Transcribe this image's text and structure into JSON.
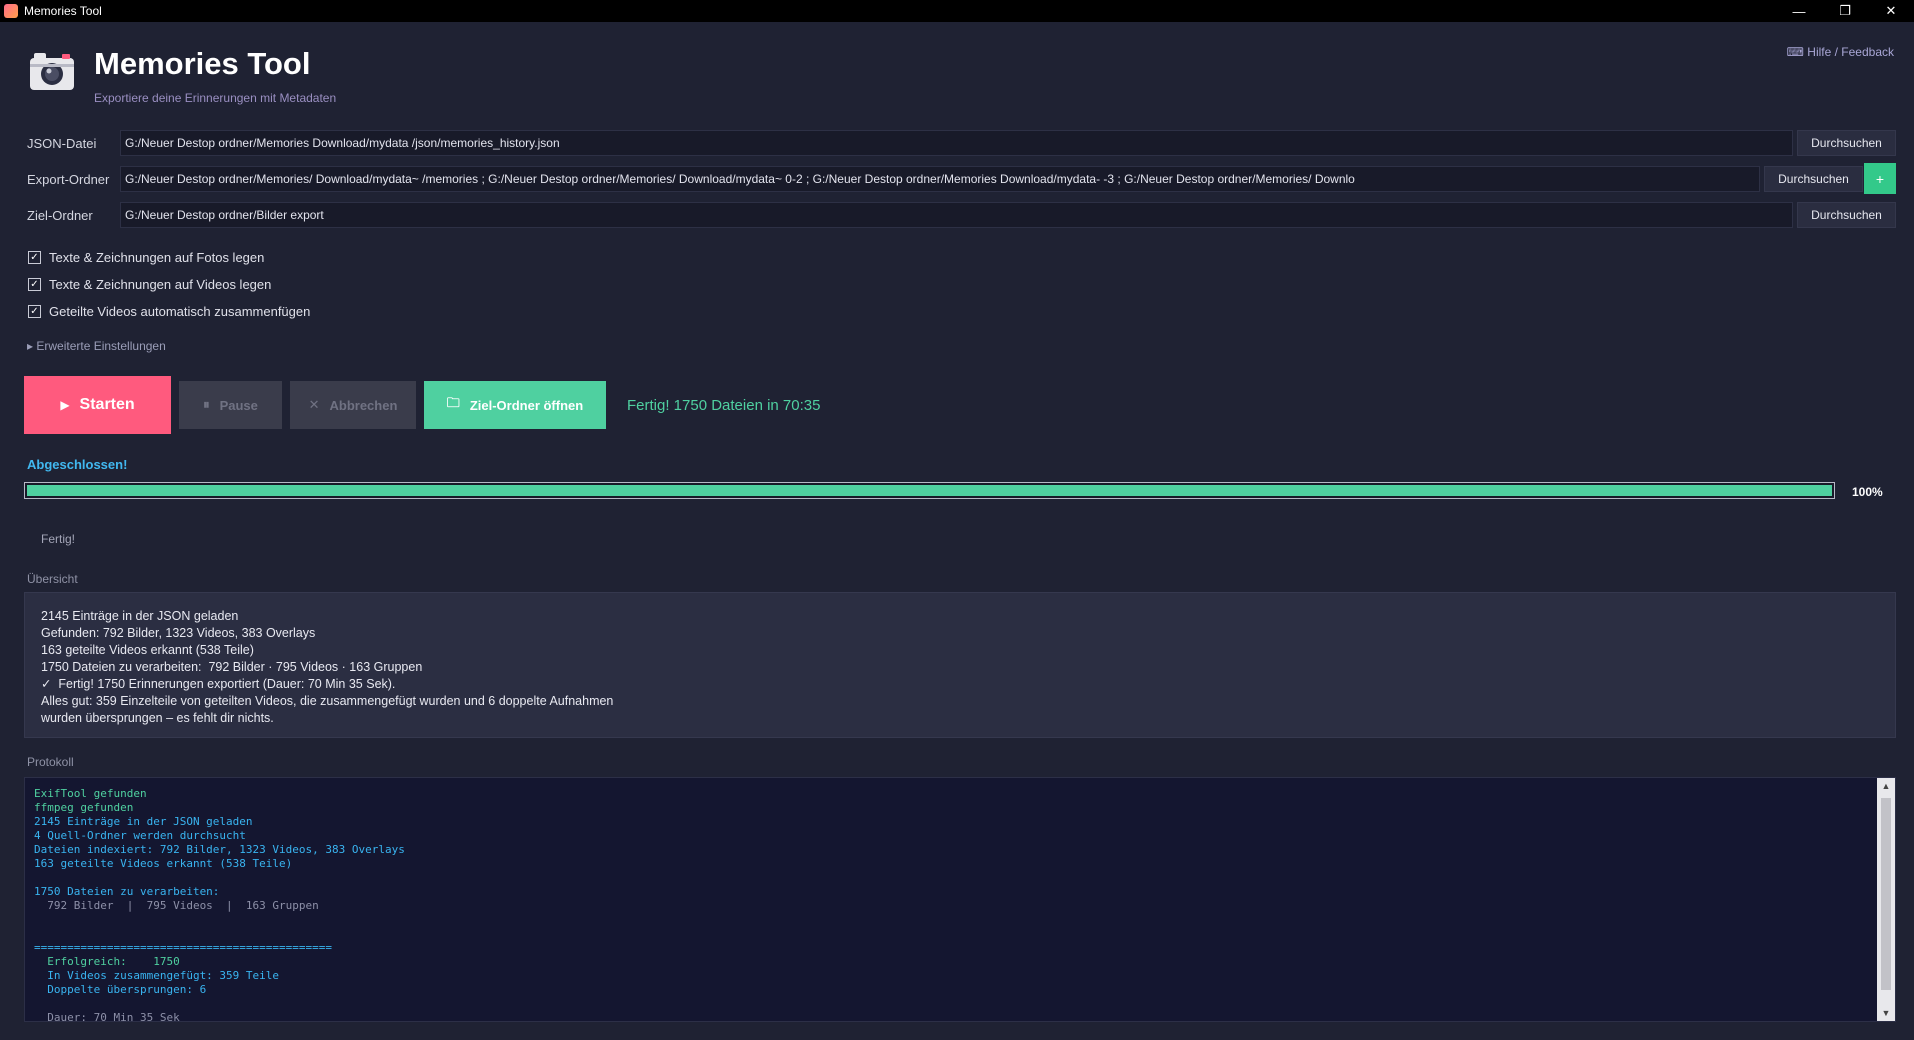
{
  "window": {
    "title": "Memories Tool",
    "minimize_glyph": "—",
    "maximize_glyph": "❐",
    "close_glyph": "✕"
  },
  "header": {
    "logo_icon": "camera-icon",
    "title": "Memories Tool",
    "subtitle": "Exportiere deine Erinnerungen mit Metadaten",
    "help_link": "Hilfe / Feedback"
  },
  "fields": {
    "json": {
      "label": "JSON-Datei",
      "value": "G:/Neuer Destop ordner/Memories                Download/mydata                              /json/memories_history.json",
      "browse_label": "Durchsuchen"
    },
    "export": {
      "label": "Export-Ordner",
      "value": "G:/Neuer Destop ordner/Memories/              Download/mydata~                              /memories ; G:/Neuer Destop ordner/Memories/              Download/mydata~                  0-2 ; G:/Neuer Destop ordner/Memories                 Download/mydata-                              -3 ; G:/Neuer Destop ordner/Memories/              Downlo",
      "browse_label": "Durchsuchen",
      "add_label": "+"
    },
    "target": {
      "label": "Ziel-Ordner",
      "value": "G:/Neuer Destop ordner/Bilder export",
      "browse_label": "Durchsuchen"
    }
  },
  "options": {
    "photo_overlay": {
      "label": "Texte & Zeichnungen auf Fotos legen",
      "checked": true
    },
    "video_overlay": {
      "label": "Texte & Zeichnungen auf Videos legen",
      "checked": true
    },
    "merge_videos": {
      "label": "Geteilte Videos automatisch zusammenfügen",
      "checked": true
    },
    "check_glyph": "✓"
  },
  "advanced": {
    "label": "▸ Erweiterte Einstellungen"
  },
  "actions": {
    "start": {
      "label": "Starten",
      "icon_glyph": "▶"
    },
    "pause": {
      "label": "Pause",
      "icon_glyph": "⏸"
    },
    "cancel": {
      "label": "Abbrechen",
      "icon_glyph": "✕"
    },
    "open_target": {
      "label": "Ziel-Ordner öffnen",
      "icon_glyph": "🗀"
    },
    "status": "Fertig! 1750 Dateien in 70:35"
  },
  "progress": {
    "heading": "Abgeschlossen!",
    "fraction": 1.0,
    "percent_label": "100%",
    "detail": "Fertig!"
  },
  "overview": {
    "label": "Übersicht",
    "lines": [
      "2145 Einträge in der JSON geladen",
      "Gefunden: 792 Bilder, 1323 Videos, 383 Overlays",
      "163 geteilte Videos erkannt (538 Teile)",
      "1750 Dateien zu verarbeiten:  792 Bilder · 795 Videos · 163 Gruppen",
      "✓  Fertig! 1750 Erinnerungen exportiert (Dauer: 70 Min 35 Sek).",
      "Alles gut: 359 Einzelteile von geteilten Videos, die zusammengefügt wurden und 6 doppelte Aufnahmen",
      "wurden übersprungen – es fehlt dir nichts."
    ]
  },
  "log": {
    "label": "Protokoll",
    "lines": [
      {
        "text": "ExifTool gefunden",
        "tone": "green"
      },
      {
        "text": "ffmpeg gefunden",
        "tone": "green"
      },
      {
        "text": "2145 Einträge in der JSON geladen",
        "tone": "blue"
      },
      {
        "text": "4 Quell-Ordner werden durchsucht",
        "tone": "blue"
      },
      {
        "text": "Dateien indexiert: 792 Bilder, 1323 Videos, 383 Overlays",
        "tone": "blue"
      },
      {
        "text": "163 geteilte Videos erkannt (538 Teile)",
        "tone": "blue"
      },
      {
        "text": "",
        "tone": "blue"
      },
      {
        "text": "1750 Dateien zu verarbeiten:",
        "tone": "blue"
      },
      {
        "text": "  792 Bilder  |  795 Videos  |  163 Gruppen",
        "tone": "gray"
      },
      {
        "text": "",
        "tone": "blue"
      },
      {
        "text": "",
        "tone": "blue"
      },
      {
        "text": "=============================================",
        "tone": "blue"
      },
      {
        "text": "  Erfolgreich:    1750",
        "tone": "green"
      },
      {
        "text": "  In Videos zusammengefügt: 359 Teile",
        "tone": "blue"
      },
      {
        "text": "  Doppelte übersprungen: 6",
        "tone": "blue"
      },
      {
        "text": "",
        "tone": "blue"
      },
      {
        "text": "  Dauer: 70 Min 35 Sek",
        "tone": "gray"
      }
    ],
    "scroll_up_glyph": "▲",
    "scroll_down_glyph": "▼"
  }
}
